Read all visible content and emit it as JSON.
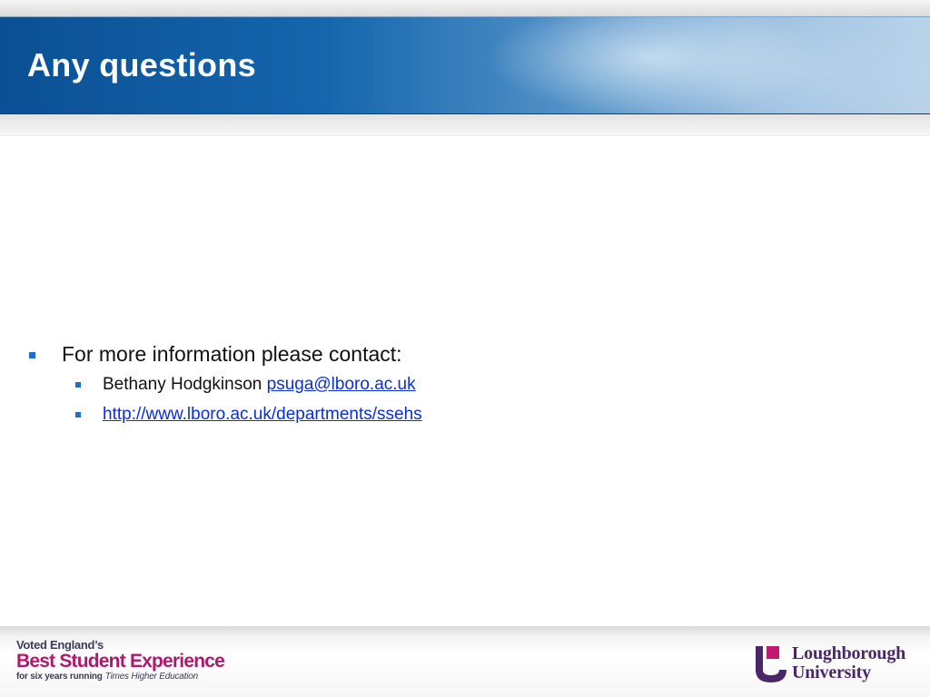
{
  "slide": {
    "title": "Any questions"
  },
  "content": {
    "level1": "For more information please contact:",
    "contact_name": "Bethany Hodgkinson",
    "contact_email": "psuga@lboro.ac.uk",
    "website": "http://www.lboro.ac.uk/departments/ssehs"
  },
  "footer": {
    "voted_line1": "Voted England’s",
    "voted_line2": "Best Student Experience",
    "voted_line3_bold": "for six years running",
    "voted_line3_italic": "Times Higher Education",
    "logo_line1": "Loughborough",
    "logo_line2": "University"
  },
  "colors": {
    "header_blue": "#1566ad",
    "bullet_blue": "#1f6fc2",
    "link_blue": "#0a2ee0",
    "brand_magenta": "#b0186e",
    "brand_purple": "#4a2868"
  }
}
